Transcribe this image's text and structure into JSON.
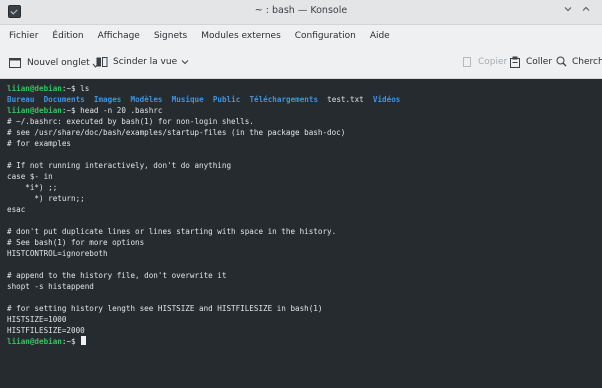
{
  "window": {
    "title": "~ : bash — Konsole",
    "icon": "terminal-app-icon",
    "controls": [
      "minimize-icon",
      "maximize-icon"
    ]
  },
  "menu": [
    "Fichier",
    "Édition",
    "Affichage",
    "Signets",
    "Modules externes",
    "Configuration",
    "Aide"
  ],
  "toolbar": {
    "new_tab": "Nouvel onglet",
    "split_view": "Scinder la vue",
    "copy": "Copier",
    "paste": "Coller",
    "find": "Chercher"
  },
  "terminal": {
    "prompt_user": "liian@debian",
    "prompt_rest": ":~$ ",
    "cmd1": "ls",
    "ls_dirs": [
      "Bureau",
      "Documents",
      "Images",
      "Modèles",
      "Musique",
      "Public",
      "Téléchargements"
    ],
    "ls_file": "test.txt",
    "ls_last_dir": "Vidéos",
    "cmd2": "head -n 20 .bashrc",
    "output": [
      "# ~/.bashrc: executed by bash(1) for non-login shells.",
      "# see /usr/share/doc/bash/examples/startup-files (in the package bash-doc)",
      "# for examples",
      "",
      "# If not running interactively, don't do anything",
      "case $- in",
      "    *i*) ;;",
      "      *) return;;",
      "esac",
      "",
      "# don't put duplicate lines or lines starting with space in the history.",
      "# See bash(1) for more options",
      "HISTCONTROL=ignoreboth",
      "",
      "# append to the history file, don't overwrite it",
      "shopt -s histappend",
      "",
      "# for setting history length see HISTSIZE and HISTFILESIZE in bash(1)",
      "HISTSIZE=1000",
      "HISTFILESIZE=2000"
    ]
  }
}
